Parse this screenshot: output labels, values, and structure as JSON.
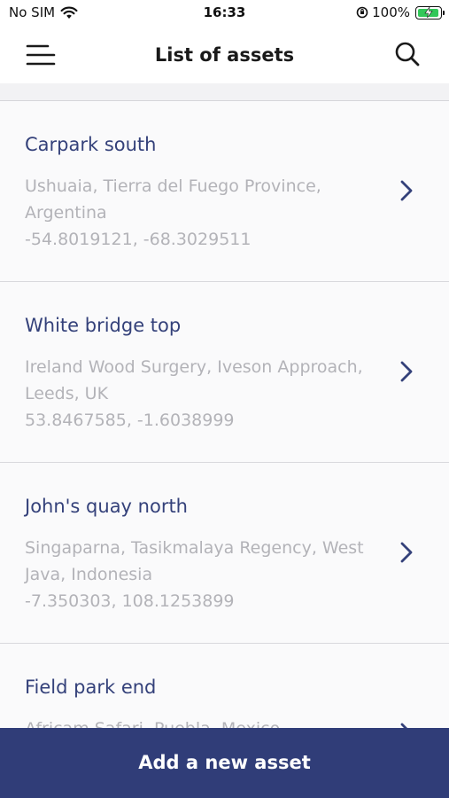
{
  "status_bar": {
    "carrier": "No SIM",
    "time": "16:33",
    "battery": "100%",
    "battery_level": 1.0,
    "icons": [
      "wifi-icon",
      "orientation-lock-icon",
      "battery-charging-icon"
    ]
  },
  "header": {
    "title": "List of assets",
    "icons": [
      "hamburger-menu-icon",
      "search-icon"
    ]
  },
  "assets": [
    {
      "name": "Carpark south",
      "address": "Ushuaia, Tierra del Fuego Province, Argentina",
      "coords": "-54.8019121, -68.3029511"
    },
    {
      "name": "White bridge top",
      "address": "Ireland Wood Surgery, Iveson Approach, Leeds, UK",
      "coords": "53.8467585, -1.6038999"
    },
    {
      "name": "John's quay north",
      "address": "Singaparna, Tasikmalaya Regency, West Java, Indonesia",
      "coords": "-7.350303, 108.1253899"
    },
    {
      "name": "Field park end",
      "address": "Africam Safari, Puebla, Mexico",
      "coords": ""
    }
  ],
  "footer": {
    "add_label": "Add a new asset"
  },
  "colors": {
    "accent": "#303d78",
    "title": "#34417a",
    "muted": "#b3b3b8",
    "charging": "#32c759"
  }
}
